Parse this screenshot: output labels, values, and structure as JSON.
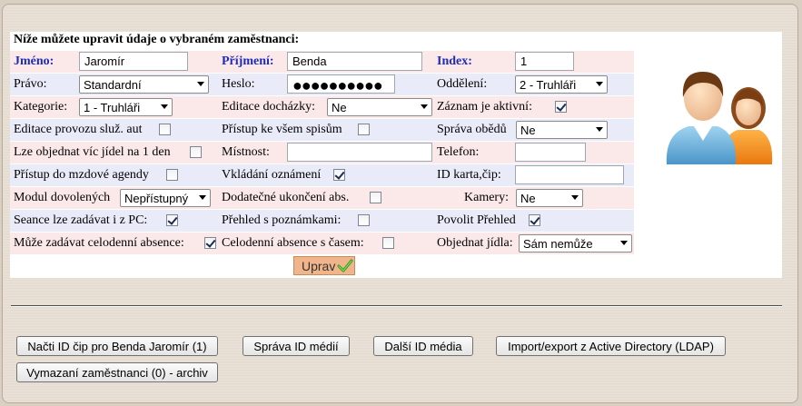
{
  "form": {
    "title": "Níže můžete upravit údaje o vybraném zaměstnanci:",
    "name_label": "Jméno:",
    "name_value": "Jaromír",
    "surname_label": "Příjmení:",
    "surname_value": "Benda",
    "index_label": "Index:",
    "index_value": "1",
    "rights_label": "Právo:",
    "rights_value": "Standardní",
    "password_label": "Heslo:",
    "password_value": "●●●●●●●●●●",
    "department_label": "Oddělení:",
    "department_value": "2 - Truhláři",
    "category_label": "Kategorie:",
    "category_value": "1 - Truhláři",
    "attendance_edit_label": "Editace docházky:",
    "attendance_edit_value": "Ne",
    "active_label": "Záznam je aktivní:",
    "active_checked": true,
    "service_edit_label": "Editace provozu služ. aut",
    "service_edit_checked": false,
    "all_files_label": "Přístup ke všem spisům",
    "all_files_checked": false,
    "lunch_mgmt_label": "Správa obědů",
    "lunch_mgmt_value": "Ne",
    "multiple_meals_label": "Lze objednat víc jídel na 1 den",
    "multiple_meals_checked": false,
    "room_label": "Místnost:",
    "room_value": "",
    "phone_label": "Telefon:",
    "phone_value": "",
    "payroll_label": "Přístup do mzdové agendy",
    "payroll_checked": false,
    "announce_label": "Vkládání oznámení",
    "announce_checked": true,
    "id_card_label": "ID karta,čip:",
    "id_card_value": "",
    "vacation_label": "Modul dovolených",
    "vacation_value": "Nepřístupný",
    "extra_end_label": "Dodatečné ukončení abs.",
    "extra_end_checked": false,
    "cameras_label": "Kamery:",
    "cameras_value": "Ne",
    "pc_sessions_label": "Seance lze zadávat i z PC:",
    "pc_sessions_checked": true,
    "notes_overview_label": "Přehled s poznámkami:",
    "notes_overview_checked": false,
    "allow_overview_label": "Povolit Přehled",
    "allow_overview_checked": true,
    "full_day_label": "Může zadávat celodenní absence:",
    "full_day_checked": true,
    "full_day_time_label": "Celodenní absence s časem:",
    "full_day_time_checked": false,
    "order_meals_label": "Objednat jídla:",
    "order_meals_value": "Sám nemůže",
    "submit_label": "Uprav"
  },
  "actions": {
    "load_chip": "Načti ID čip pro Benda Jaromír (1)",
    "media_mgmt": "Správa ID médií",
    "next_media": "Další ID média",
    "ad_import": "Import/export z Active Directory (LDAP)",
    "archive": "Vymazaní zaměstnanci (0) - archiv"
  },
  "icons": [
    "users-avatar-icon",
    "checkmark-icon",
    "chevron-down-icon"
  ],
  "colors": {
    "label_blue": "#1f2bb8",
    "band_pink": "#fbe9ea",
    "band_blue": "#e9ecf8",
    "submit_bg": "#f0b58a"
  }
}
